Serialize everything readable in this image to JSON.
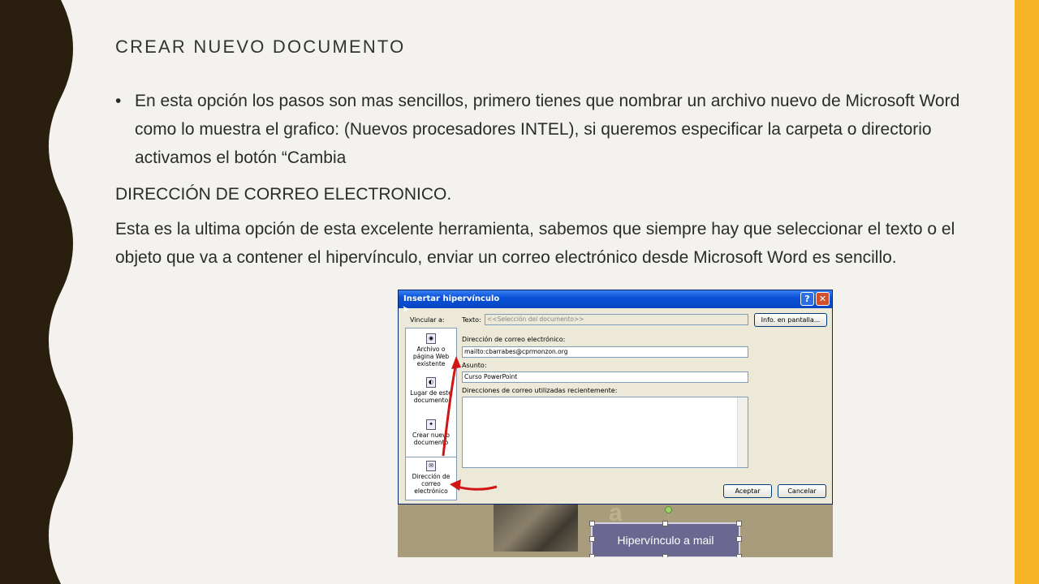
{
  "slide": {
    "title": "CREAR NUEVO DOCUMENTO",
    "bullet": "En esta opción los pasos son mas sencillos, primero tienes que nombrar un archivo nuevo de Microsoft Word como lo muestra el grafico: (Nuevos procesadores INTEL), si queremos especificar la carpeta o directorio activamos el botón “Cambia",
    "heading2": "DIRECCIÓN DE CORREO ELECTRONICO.",
    "paragraph": "Esta es la ultima opción de esta excelente herramienta, sabemos que siempre hay que seleccionar el texto o el objeto que va a contener el hipervínculo, enviar un correo electrónico desde Microsoft Word es sencillo.",
    "colors": {
      "accent_bar": "#f7b526",
      "wave": "#2a1e0e",
      "background": "#f3f2ef"
    }
  },
  "dialog": {
    "title": "Insertar hipervínculo",
    "help_label": "?",
    "close_label": "✕",
    "vincular_label": "Vincular a:",
    "texto_label": "Texto:",
    "texto_value": "<<Selección del documento>>",
    "info_button": "Info. en pantalla...",
    "nav": [
      {
        "label": "Archivo o página Web existente",
        "icon": "web-page-icon"
      },
      {
        "label": "Lugar de este documento",
        "icon": "bookmark-icon"
      },
      {
        "label": "Crear nuevo documento",
        "icon": "new-document-icon"
      },
      {
        "label": "Dirección de correo electrónico",
        "icon": "email-icon"
      }
    ],
    "email_label": "Dirección de correo electrónico:",
    "email_value": "mailto:cbarrabes@cprmonzon.org",
    "asunto_label": "Asunto:",
    "asunto_value": "Curso PowerPoint",
    "recent_label": "Direcciones de correo utilizadas recientemente:",
    "accept": "Aceptar",
    "cancel": "Cancelar"
  },
  "canvas": {
    "hyperlink_shape_label": "Hipervínculo a mail"
  }
}
